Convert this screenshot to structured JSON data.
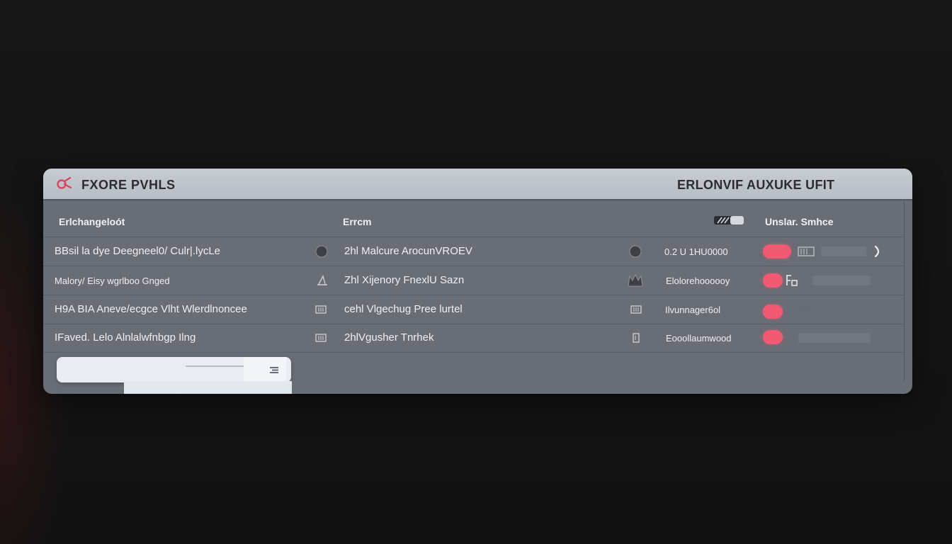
{
  "window": {
    "title": "FXORE PVHLS",
    "title_right": "ERLONVIF AUXUKE UFIT"
  },
  "table": {
    "headers": {
      "col1": "Erlchangeloót",
      "col2": "Errcm",
      "col3": "Unslar. Smhce"
    },
    "rows": [
      {
        "name": "BBsil la dye  Deegneel0/ Culr|.lycLe",
        "detail": "2hl Malcure ArocunVROEV",
        "status": "0.2 U 1HU0000",
        "toggle": "on",
        "trail_icon": "chevron-right-icon"
      },
      {
        "name": "Malory/  Eisy wgrlboo Gnged",
        "detail": "Zhl Xijenory FnexlU Sazn",
        "status": "Elolorehoooooy",
        "toggle": "on",
        "trail_icon": "lock-icon"
      },
      {
        "name": "H9A BIA Aneve/ecgce Vlht Wlerdlnoncee",
        "detail": "cehl Vlgechug Pree lurtel",
        "status": "Ilvunnager6ol",
        "toggle": "on",
        "trail_icon": ""
      },
      {
        "name": "IFaved.  Lelo Alnlalwfnbgp Ilng",
        "detail": "2hlVgusher Tnrhek",
        "status": "Eooollaumwood",
        "toggle": "on",
        "trail_icon": ""
      }
    ]
  },
  "colors": {
    "accent": "#f25a74",
    "titlebar": "#c0c5cd",
    "panel": "#686d76",
    "background": "#141414"
  },
  "footer": {
    "input_value": ""
  }
}
